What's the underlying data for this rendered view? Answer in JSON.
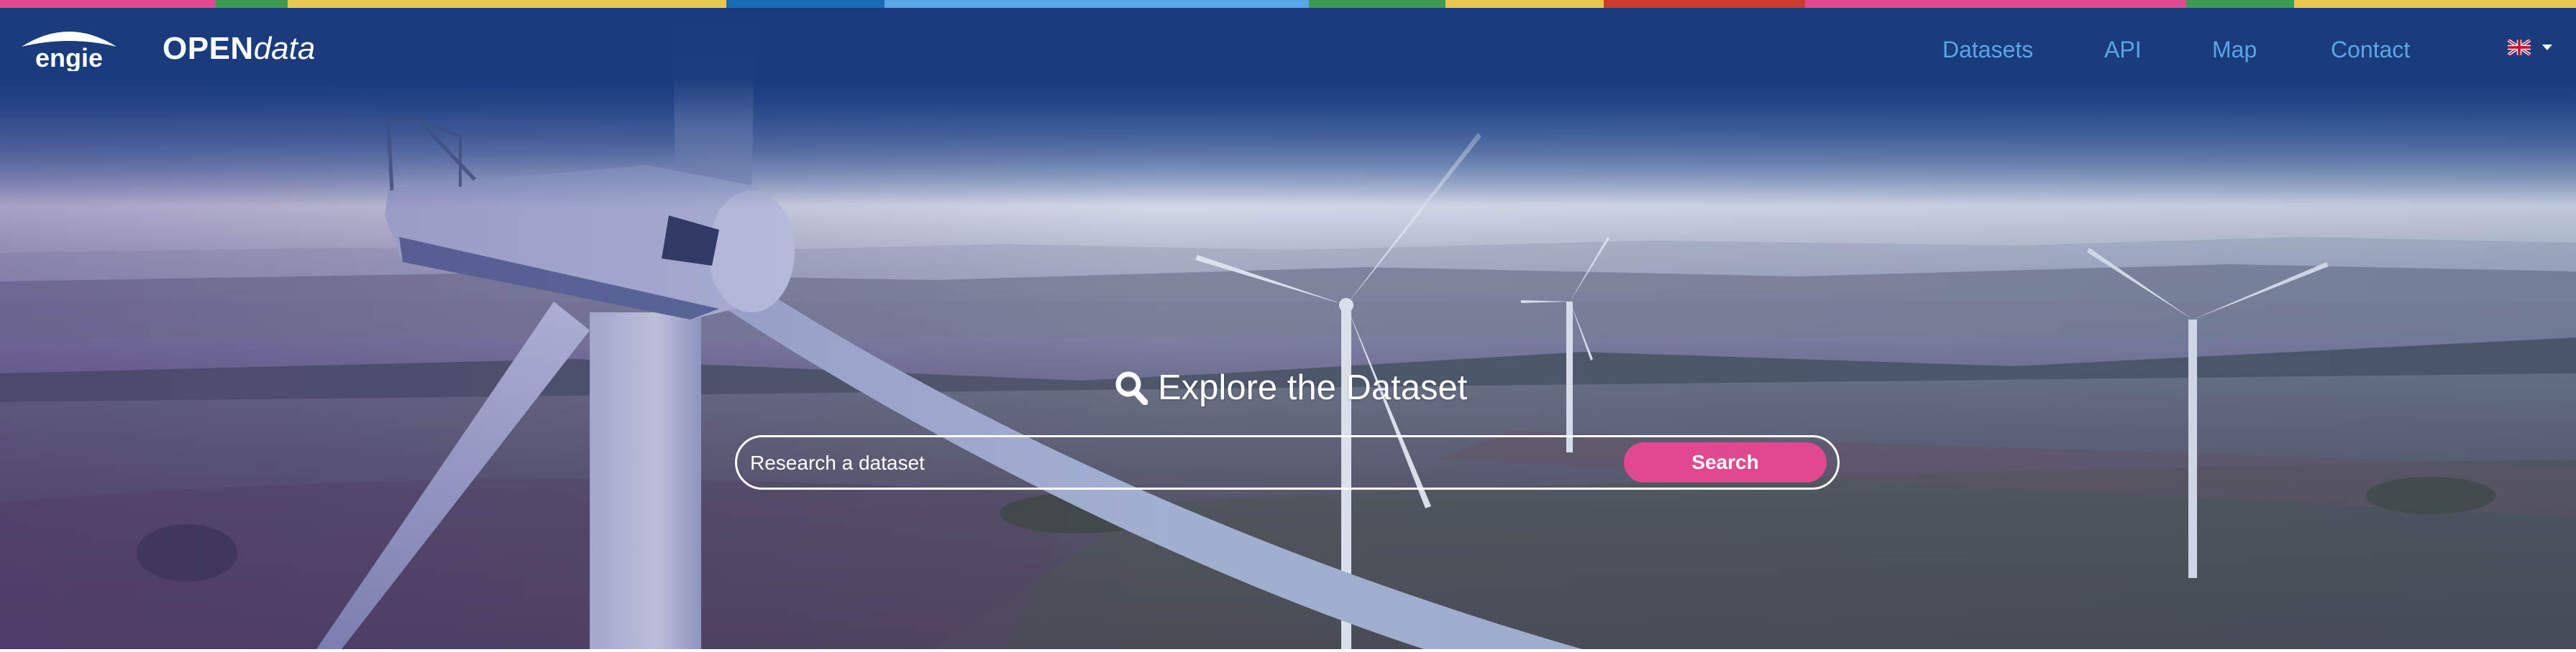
{
  "brand": {
    "logo_alt": "engie",
    "opendata_strong": "OPEN",
    "opendata_light": "data"
  },
  "nav": [
    {
      "label": "Datasets"
    },
    {
      "label": "API"
    },
    {
      "label": "Map"
    },
    {
      "label": "Contact"
    }
  ],
  "language": {
    "icon": "uk-flag-icon"
  },
  "hero": {
    "title": "Explore the Dataset",
    "title_icon": "search-icon"
  },
  "search": {
    "placeholder": "Research a dataset",
    "value": "",
    "button_label": "Search"
  },
  "colors": {
    "header_blue": "#1d3f80",
    "nav_link": "#58a6e8",
    "search_button": "#e0498f",
    "stripe": [
      "#e0498f",
      "#3d9a53",
      "#e8c94c",
      "#1a6bb5",
      "#58a6e8",
      "#3d9a53",
      "#e8c94c",
      "#cc3b2e",
      "#e0498f",
      "#3d9a53",
      "#e8c94c"
    ]
  }
}
